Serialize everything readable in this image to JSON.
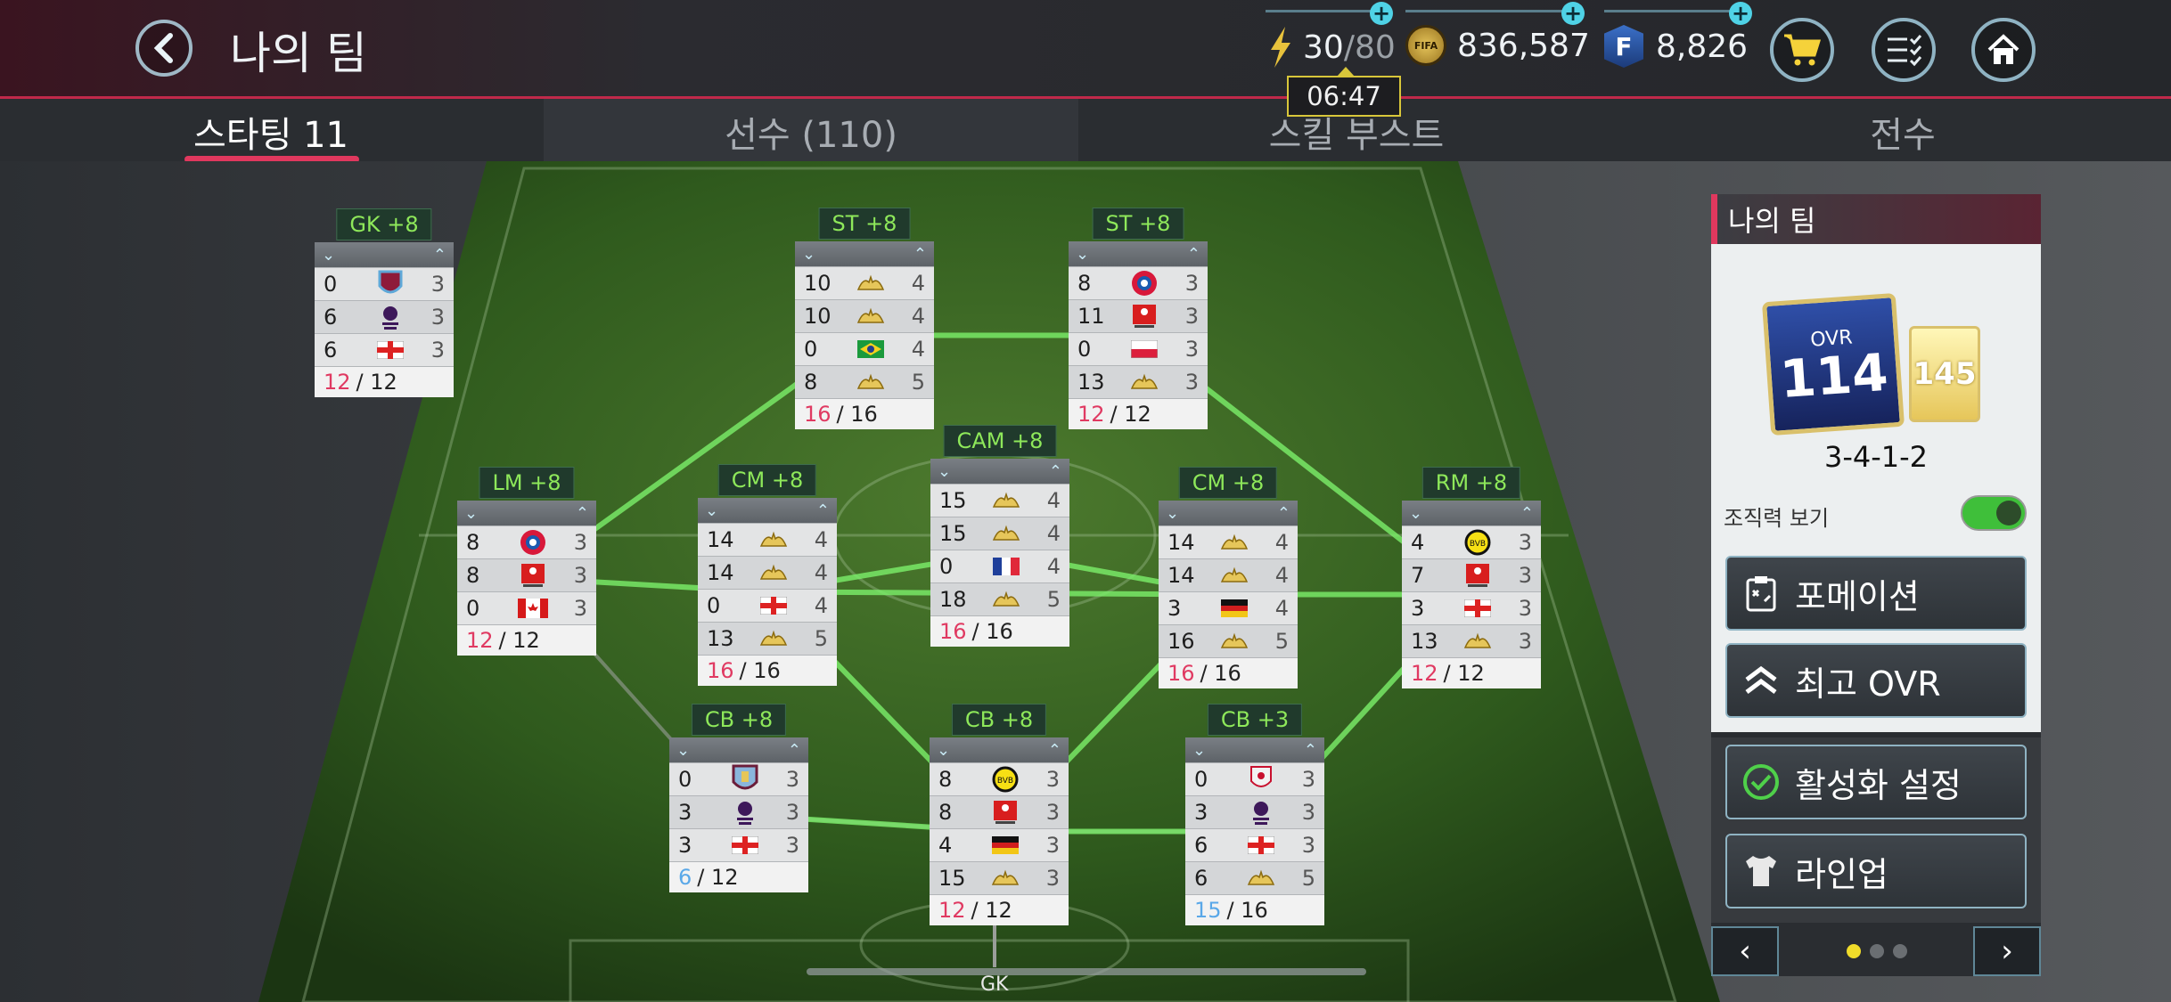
{
  "header": {
    "title": "나의 팀",
    "energy": {
      "current": "30",
      "max": "80"
    },
    "coins": "836,587",
    "fpoints": "8,826",
    "timer": "06:47",
    "coin_label": "FIFA"
  },
  "tabs": [
    "스타팅 11",
    "선수 (110)",
    "스킬 부스트",
    "전수"
  ],
  "field": {
    "gk_label": "GK"
  },
  "cards": [
    {
      "pos": "GK",
      "boost": "+8",
      "rows": [
        [
          "0",
          "burnley-crest",
          "3"
        ],
        [
          "6",
          "premier-league-logo",
          "3"
        ],
        [
          "6",
          "england-flag",
          "3"
        ]
      ],
      "cur": "12",
      "max": "12"
    },
    {
      "pos": "ST",
      "boost": "+8",
      "rows": [
        [
          "10",
          "crown-icon",
          "4"
        ],
        [
          "10",
          "crown-icon",
          "4"
        ],
        [
          "0",
          "brazil-flag",
          "4"
        ],
        [
          "8",
          "crown-icon",
          "5"
        ]
      ],
      "cur": "16",
      "max": "16"
    },
    {
      "pos": "ST",
      "boost": "+8",
      "rows": [
        [
          "8",
          "bayern-crest",
          "3"
        ],
        [
          "11",
          "bundesliga-logo",
          "3"
        ],
        [
          "0",
          "poland-flag",
          "3"
        ],
        [
          "13",
          "crown-icon",
          "3"
        ]
      ],
      "cur": "12",
      "max": "12"
    },
    {
      "pos": "CAM",
      "boost": "+8",
      "rows": [
        [
          "15",
          "crown-icon",
          "4"
        ],
        [
          "15",
          "crown-icon",
          "4"
        ],
        [
          "0",
          "france-flag",
          "4"
        ],
        [
          "18",
          "crown-icon",
          "5"
        ]
      ],
      "cur": "16",
      "max": "16"
    },
    {
      "pos": "LM",
      "boost": "+8",
      "rows": [
        [
          "8",
          "bayern-crest",
          "3"
        ],
        [
          "8",
          "bundesliga-logo",
          "3"
        ],
        [
          "0",
          "canada-flag",
          "3"
        ]
      ],
      "cur": "12",
      "max": "12"
    },
    {
      "pos": "CM",
      "boost": "+8",
      "rows": [
        [
          "14",
          "crown-icon",
          "4"
        ],
        [
          "14",
          "crown-icon",
          "4"
        ],
        [
          "0",
          "england-flag",
          "4"
        ],
        [
          "13",
          "crown-icon",
          "5"
        ]
      ],
      "cur": "16",
      "max": "16"
    },
    {
      "pos": "CM",
      "boost": "+8",
      "rows": [
        [
          "14",
          "crown-icon",
          "4"
        ],
        [
          "14",
          "crown-icon",
          "4"
        ],
        [
          "3",
          "germany-flag",
          "4"
        ],
        [
          "16",
          "crown-icon",
          "5"
        ]
      ],
      "cur": "16",
      "max": "16"
    },
    {
      "pos": "RM",
      "boost": "+8",
      "rows": [
        [
          "4",
          "dortmund-crest",
          "3"
        ],
        [
          "7",
          "bundesliga-logo",
          "3"
        ],
        [
          "3",
          "england-flag",
          "3"
        ],
        [
          "13",
          "crown-icon",
          "3"
        ]
      ],
      "cur": "12",
      "max": "12"
    },
    {
      "pos": "CB",
      "boost": "+8",
      "rows": [
        [
          "0",
          "aston-villa-crest",
          "3"
        ],
        [
          "3",
          "premier-league-logo",
          "3"
        ],
        [
          "3",
          "england-flag",
          "3"
        ]
      ],
      "cur": "6",
      "max": "12"
    },
    {
      "pos": "CB",
      "boost": "+8",
      "rows": [
        [
          "8",
          "dortmund-crest",
          "3"
        ],
        [
          "8",
          "bundesliga-logo",
          "3"
        ],
        [
          "4",
          "germany-flag",
          "3"
        ],
        [
          "15",
          "crown-icon",
          "3"
        ]
      ],
      "cur": "12",
      "max": "12"
    },
    {
      "pos": "CB",
      "boost": "+3",
      "rows": [
        [
          "0",
          "liverpool-crest",
          "3"
        ],
        [
          "3",
          "premier-league-logo",
          "3"
        ],
        [
          "6",
          "england-flag",
          "3"
        ],
        [
          "6",
          "crown-icon",
          "5"
        ]
      ],
      "cur": "15",
      "max": "16"
    }
  ],
  "panel": {
    "title": "나의 팀",
    "ovr_label": "OVR",
    "ovr": "114",
    "alt_ovr": "145",
    "formation": "3-4-1-2",
    "toggle_label": "조직력 보기",
    "toggle_on": true,
    "buttons": {
      "formation": "포메이션",
      "best": "최고 OVR",
      "activate": "활성화 설정",
      "lineup": "라인업"
    },
    "pager": {
      "prev": "‹",
      "next": "›",
      "pages": 3,
      "current": 1
    }
  },
  "colors": {
    "accent": "#e0385e",
    "boost_green": "#8ee85a",
    "toggle_on": "#3fbf3a",
    "link_line": "#7cf06a"
  }
}
